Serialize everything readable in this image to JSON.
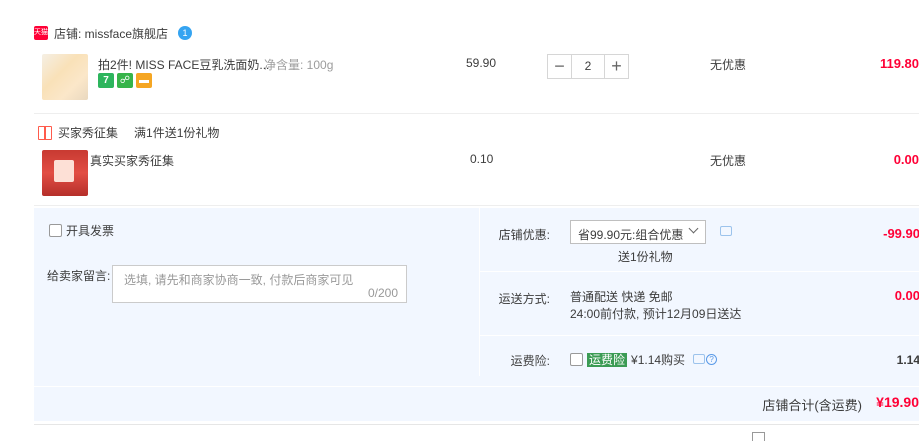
{
  "shop": {
    "badge_text": "天猫",
    "label": "店铺: missface旗舰店",
    "chat_badge": "1"
  },
  "items": [
    {
      "title": "拍2件! MISS FACE豆乳洗面奶...",
      "sku": "净含量: 100g",
      "badges": [
        "7",
        "shield-icon",
        "card-icon"
      ],
      "price": "59.90",
      "quantity": "2",
      "promo": "无优惠",
      "subtotal": "119.80"
    },
    {
      "title": "真实买家秀征集",
      "price": "0.10",
      "promo": "无优惠",
      "subtotal": "0.00"
    }
  ],
  "gift": {
    "label": "买家秀征集",
    "note": "满1件送1份礼物"
  },
  "invoice_label": "开具发票",
  "message": {
    "label": "给卖家留言:",
    "placeholder": "选填, 请先和商家协商一致, 付款后商家可见",
    "counter": "0/200"
  },
  "discount": {
    "label": "店铺优惠:",
    "selected": "省99.90元:组合优惠",
    "gift_note": "送1份礼物",
    "value": "-99.90"
  },
  "shipping": {
    "label": "运送方式:",
    "method": "普通配送 快递 免邮",
    "eta": "24:00前付款, 预计12月09日送达",
    "value": "0.00"
  },
  "insurance": {
    "label": "运费险:",
    "tag": "运费险",
    "text": "¥1.14购买",
    "value": "1.14"
  },
  "total": {
    "label": "店铺合计(含运费)",
    "value": "¥19.90"
  },
  "colors": {
    "accent_red": "#ff0036",
    "summary_bg": "#f2f7ff"
  }
}
